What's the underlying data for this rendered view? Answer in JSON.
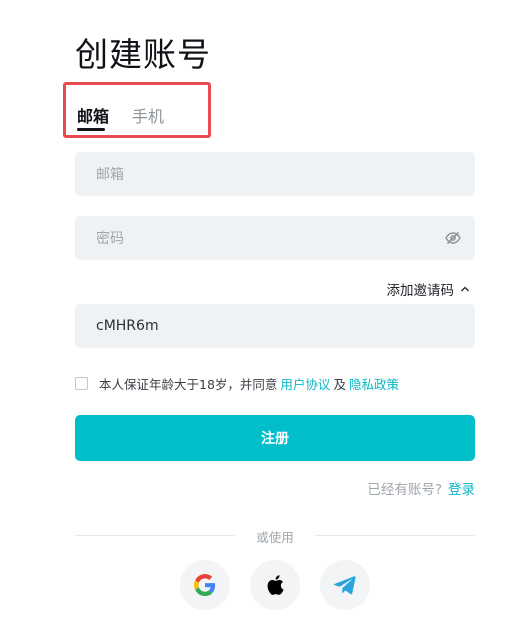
{
  "page": {
    "title": "创建账号"
  },
  "tabs": [
    {
      "label": "邮箱",
      "active": true
    },
    {
      "label": "手机",
      "active": false
    }
  ],
  "form": {
    "email_placeholder": "邮箱",
    "password_placeholder": "密码",
    "invite_toggle_label": "添加邀请码",
    "invite_code_value": "cMHR6m"
  },
  "agreement": {
    "prefix": "本人保证年龄大于18岁，并同意",
    "user_agreement_link": "用户协议",
    "and": "及",
    "privacy_policy_link": "隐私政策",
    "checked": false
  },
  "buttons": {
    "register_label": "注册"
  },
  "login": {
    "prompt": "已经有账号?",
    "link_label": "登录"
  },
  "social": {
    "divider_label": "或使用",
    "providers": [
      {
        "icon": "google-icon"
      },
      {
        "icon": "apple-icon"
      },
      {
        "icon": "telegram-icon"
      }
    ]
  },
  "colors": {
    "accent": "#00bfca",
    "link": "#0ab7c4",
    "highlight_border": "#e84a4f",
    "field_bg": "#eff2f4"
  }
}
